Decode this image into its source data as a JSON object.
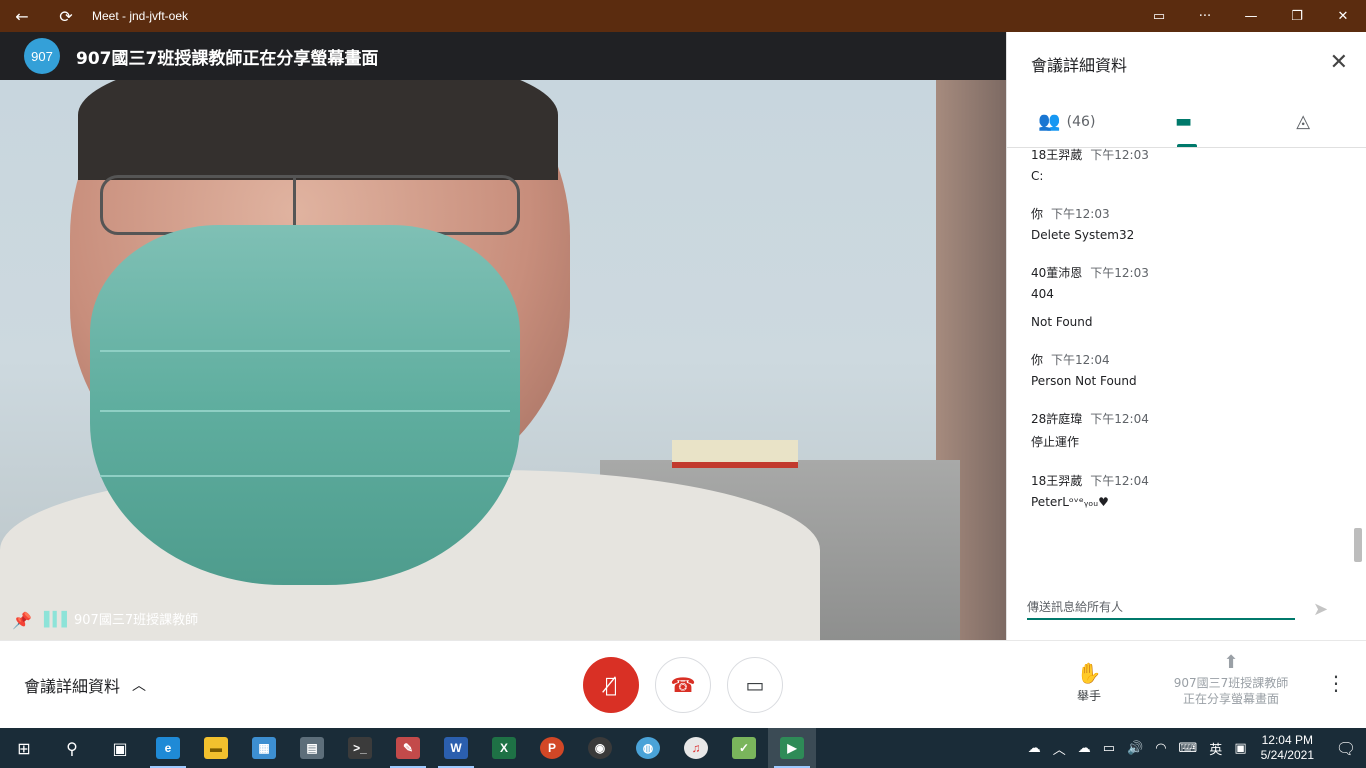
{
  "titlebar": {
    "title": "Meet - jnd-jvft-oek",
    "back_icon": "back-arrow-icon",
    "refresh_icon": "refresh-icon",
    "camera_icon": "camera-icon",
    "more_icon": "more-horizontal-icon",
    "minimize": "—",
    "maximize": "❐",
    "close": "✕"
  },
  "video": {
    "badge": "907",
    "header_text": "907國三7班授課教師正在分享螢幕畫面",
    "participant_name": "907國三7班授課教師"
  },
  "panel": {
    "title": "會議詳細資料",
    "tabs": [
      {
        "label": "(46)",
        "icon": "people-icon"
      },
      {
        "label": "",
        "icon": "chat-icon"
      },
      {
        "label": "",
        "icon": "activities-icon"
      }
    ],
    "messages": [
      {
        "sender": "18王羿葳",
        "time": "下午12:03",
        "lines": [
          "C:"
        ]
      },
      {
        "sender": "你",
        "time": "下午12:03",
        "lines": [
          "Delete System32"
        ]
      },
      {
        "sender": "40董沛恩",
        "time": "下午12:03",
        "lines": [
          "404",
          "Not Found"
        ]
      },
      {
        "sender": "你",
        "time": "下午12:04",
        "lines": [
          "Person Not Found"
        ]
      },
      {
        "sender": "28許庭瑋",
        "time": "下午12:04",
        "lines": [
          "停止運作"
        ]
      },
      {
        "sender": "18王羿葳",
        "time": "下午12:04",
        "lines": [
          "PeterLᵒᵛᵉᵧₒᵤ♥"
        ]
      }
    ],
    "input_placeholder": "傳送訊息給所有人"
  },
  "controls": {
    "details_label": "會議詳細資料",
    "raise_hand": "舉手",
    "presenting_line1": "907國三7班授課教師",
    "presenting_line2": "正在分享螢幕畫面"
  },
  "taskbar": {
    "ime": "英",
    "time": "12:04 PM",
    "date": "5/24/2021",
    "apps": [
      {
        "name": "edge-icon",
        "color": "#1f8ad6",
        "glyph": "e"
      },
      {
        "name": "file-explorer-icon",
        "color": "#f2c12e",
        "glyph": "▬"
      },
      {
        "name": "control-panel-icon",
        "color": "#3d8fd1",
        "glyph": "▦"
      },
      {
        "name": "store-icon",
        "color": "#5d6e7a",
        "glyph": "🛍"
      },
      {
        "name": "terminal-icon",
        "color": "#3b3b3b",
        "glyph": ">_"
      },
      {
        "name": "paint-icon",
        "color": "#c34a4a",
        "glyph": "✎"
      },
      {
        "name": "word-icon",
        "color": "#2b5fae",
        "glyph": "W"
      },
      {
        "name": "excel-icon",
        "color": "#1e7145",
        "glyph": "X"
      },
      {
        "name": "powerpoint-icon",
        "color": "#d24726",
        "glyph": "P"
      },
      {
        "name": "obs-icon",
        "color": "#3a3a3a",
        "glyph": "◉"
      },
      {
        "name": "globe-icon",
        "color": "#4aa3d8",
        "glyph": "◍"
      },
      {
        "name": "itunes-icon",
        "color": "#e8e8e8",
        "glyph": "♫"
      },
      {
        "name": "notepad-icon",
        "color": "#7ab55c",
        "glyph": "✓"
      },
      {
        "name": "meet-icon",
        "color": "#2e8b57",
        "glyph": "▶"
      }
    ]
  }
}
